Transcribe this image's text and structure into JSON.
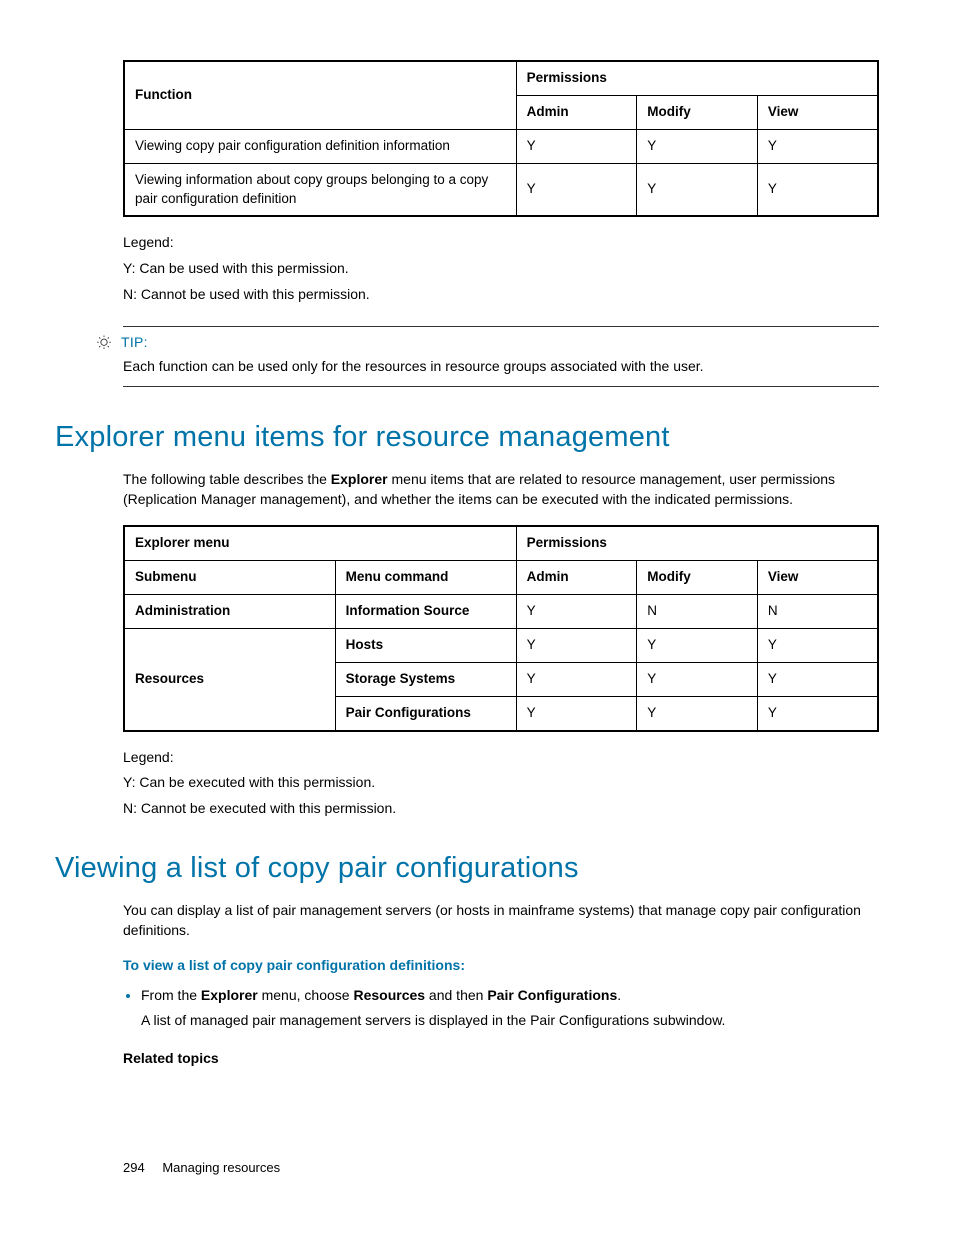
{
  "table1": {
    "h_function": "Function",
    "h_permissions": "Permissions",
    "h_admin": "Admin",
    "h_modify": "Modify",
    "h_view": "View",
    "rows": [
      {
        "func": "Viewing copy pair configuration definition information",
        "admin": "Y",
        "modify": "Y",
        "view": "Y"
      },
      {
        "func": "Viewing information about copy groups belonging to a copy pair configuration definition",
        "admin": "Y",
        "modify": "Y",
        "view": "Y"
      }
    ]
  },
  "legend1": {
    "title": "Legend:",
    "y": "Y: Can be used with this permission.",
    "n": "N: Cannot be used with this permission."
  },
  "tip": {
    "label": "TIP:",
    "text": "Each function can be used only for the resources in resource groups associated with the user."
  },
  "section1": {
    "heading": "Explorer menu items for resource management",
    "intro_pre": "The following table describes the ",
    "intro_bold1": "Explorer",
    "intro_post": " menu items that are related to resource management, user permissions (Replication Manager management), and whether the items can be executed with the indicated permissions."
  },
  "table2": {
    "h_explorer": "Explorer menu",
    "h_permissions": "Permissions",
    "h_submenu": "Submenu",
    "h_menucmd": "Menu command",
    "h_admin": "Admin",
    "h_modify": "Modify",
    "h_view": "View",
    "group1_label": "Administration",
    "group1_rows": [
      {
        "cmd": "Information Source",
        "admin": "Y",
        "modify": "N",
        "view": "N"
      }
    ],
    "group2_label": "Resources",
    "group2_rows": [
      {
        "cmd": "Hosts",
        "admin": "Y",
        "modify": "Y",
        "view": "Y"
      },
      {
        "cmd": "Storage Systems",
        "admin": "Y",
        "modify": "Y",
        "view": "Y"
      },
      {
        "cmd": "Pair Configurations",
        "admin": "Y",
        "modify": "Y",
        "view": "Y"
      }
    ]
  },
  "legend2": {
    "title": "Legend:",
    "y": "Y: Can be executed with this permission.",
    "n": "N: Cannot be executed with this permission."
  },
  "section2": {
    "heading": "Viewing a list of copy pair configurations",
    "intro": "You can display a list of pair management servers (or hosts in mainframe systems) that manage copy pair configuration definitions.",
    "sub_head": "To view a list of copy pair configuration definitions:",
    "bullet_pre": "From the ",
    "bullet_b1": "Explorer",
    "bullet_mid1": " menu, choose ",
    "bullet_b2": "Resources",
    "bullet_mid2": " and then ",
    "bullet_b3": "Pair Configurations",
    "bullet_end": ".",
    "bullet_sub": "A list of managed pair management servers is displayed in the Pair Configurations subwindow.",
    "related": "Related topics"
  },
  "footer": {
    "page": "294",
    "title": "Managing resources"
  }
}
